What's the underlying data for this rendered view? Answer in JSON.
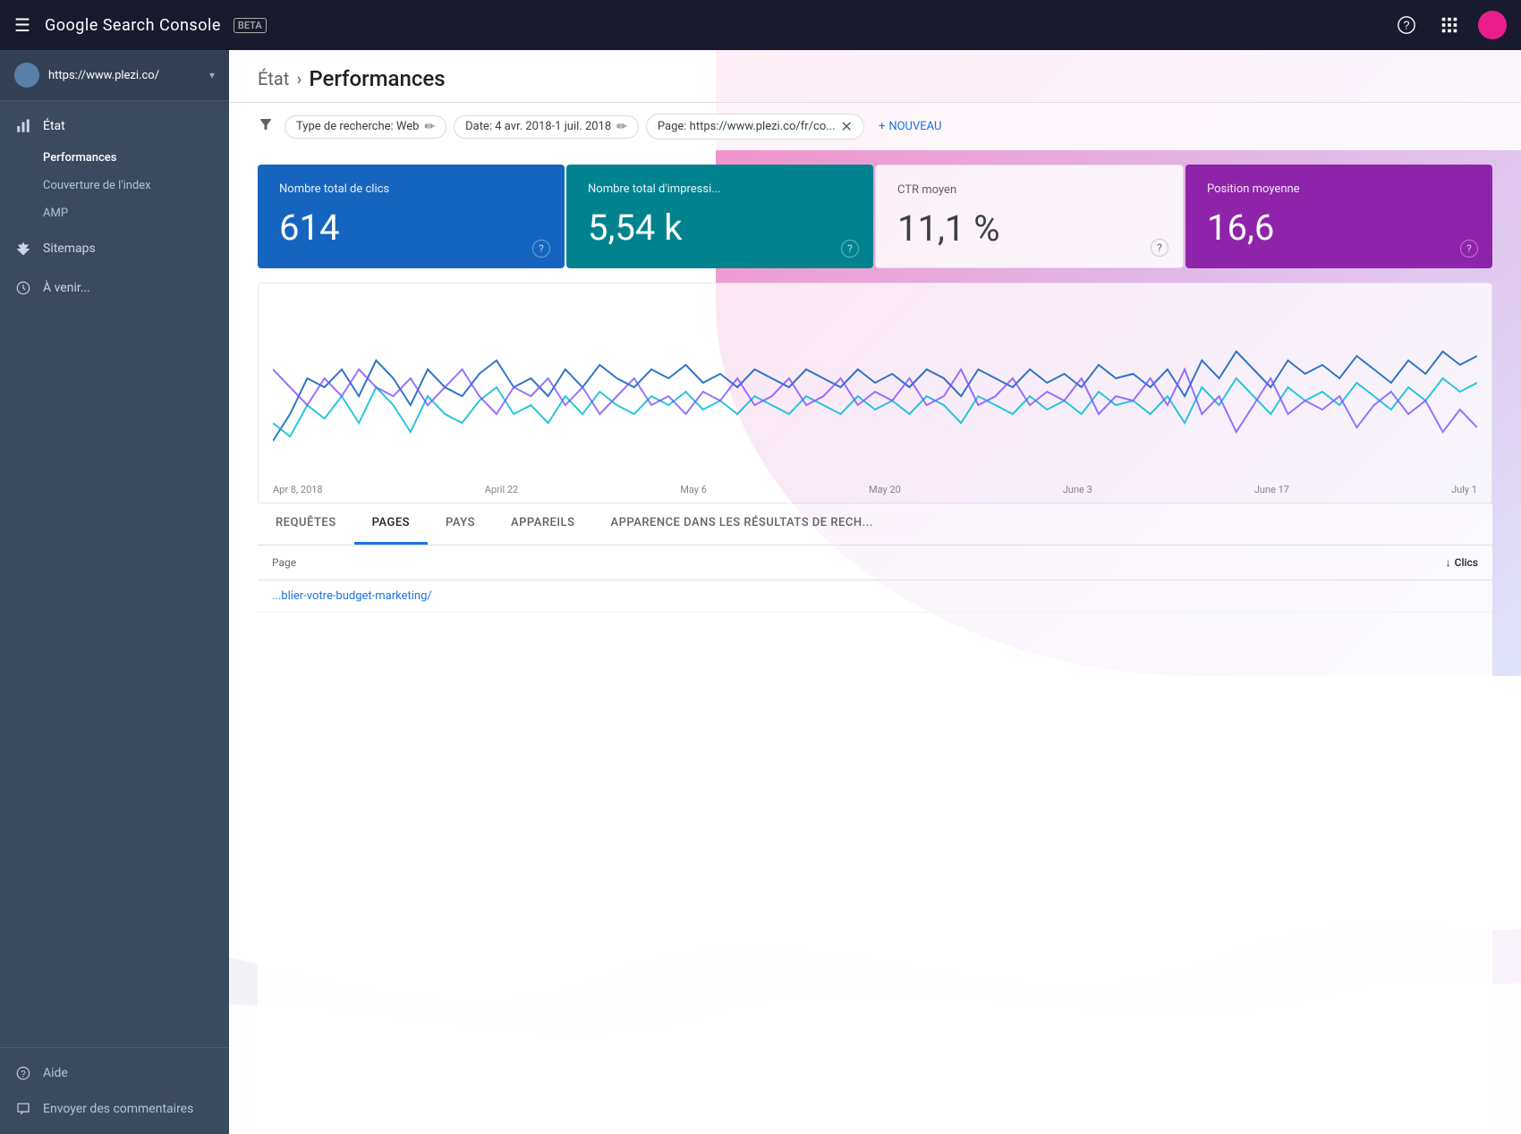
{
  "topbar": {
    "menu_icon": "☰",
    "logo_text": "Google Search Console",
    "beta_label": "BETA",
    "help_icon": "?",
    "grid_icon": "⋮⋮",
    "right_icons": [
      "help",
      "apps",
      "account"
    ]
  },
  "sidebar": {
    "property": {
      "url": "https://www.plezi.co/",
      "chevron": "▾"
    },
    "nav_items": [
      {
        "id": "etat",
        "label": "État",
        "icon": "bar_chart",
        "active": true,
        "sub_items": [
          {
            "id": "performances",
            "label": "Performances",
            "active": true
          },
          {
            "id": "couverture",
            "label": "Couverture de l'index",
            "active": false
          },
          {
            "id": "amp",
            "label": "AMP",
            "active": false
          }
        ]
      },
      {
        "id": "sitemaps",
        "label": "Sitemaps",
        "icon": "sitemap",
        "active": false,
        "sub_items": []
      },
      {
        "id": "avenir",
        "label": "À venir...",
        "icon": "upcoming",
        "active": false,
        "sub_items": []
      }
    ],
    "bottom_items": [
      {
        "id": "aide",
        "label": "Aide",
        "icon": "help"
      },
      {
        "id": "envoyer",
        "label": "Envoyer des commentaires",
        "icon": "feedback"
      }
    ]
  },
  "breadcrumb": {
    "parent": "État",
    "separator": "›",
    "current": "Performances"
  },
  "filters": {
    "filter_icon": "⚙",
    "chips": [
      {
        "id": "search_type",
        "label": "Type de recherche: Web",
        "has_edit": true,
        "has_close": false
      },
      {
        "id": "date",
        "label": "Date: 4 avr. 2018-1 juil. 2018",
        "has_edit": true,
        "has_close": false
      },
      {
        "id": "page",
        "label": "Page: https://www.plezi.co/fr/co...",
        "has_edit": false,
        "has_close": true
      }
    ],
    "add_label": "NOUVEAU",
    "add_icon": "+"
  },
  "metrics": [
    {
      "id": "clicks",
      "label": "Nombre total de clics",
      "value": "614",
      "theme": "blue",
      "help": "?"
    },
    {
      "id": "impressions",
      "label": "Nombre total d'impressi...",
      "value": "5,54 k",
      "theme": "teal",
      "help": "?"
    },
    {
      "id": "ctr",
      "label": "CTR moyen",
      "value": "11,1 %",
      "theme": "light",
      "help": "?"
    },
    {
      "id": "position",
      "label": "Position moyenne",
      "value": "16,6",
      "theme": "purple",
      "help": "?"
    }
  ],
  "chart": {
    "x_labels": [
      "Apr 8, 2018",
      "April 22",
      "May 6",
      "May 20",
      "June 3",
      "June 17",
      "July 1"
    ]
  },
  "tabs": [
    {
      "id": "requetes",
      "label": "REQUÊTES",
      "active": false
    },
    {
      "id": "pages",
      "label": "PAGES",
      "active": true
    },
    {
      "id": "pays",
      "label": "PAYS",
      "active": false
    },
    {
      "id": "appareils",
      "label": "APPAREILS",
      "active": false
    },
    {
      "id": "apparence",
      "label": "APPARENCE DANS LES RÉSULTATS DE RECH...",
      "active": false
    }
  ],
  "table": {
    "columns": [
      {
        "id": "page",
        "label": "Page"
      },
      {
        "id": "clics",
        "label": "Clics",
        "sort_icon": "↓"
      }
    ],
    "rows": [
      {
        "page": "...blier-votre-budget-marketing/",
        "clics": ""
      }
    ]
  },
  "colors": {
    "topbar_bg": "#1a1a2e",
    "sidebar_bg": "#3c4a5e",
    "metric_blue": "#1565c0",
    "metric_teal": "#00838f",
    "metric_purple": "#8e24aa",
    "accent_pink": "#e91e8c",
    "link_blue": "#1a73e8"
  }
}
